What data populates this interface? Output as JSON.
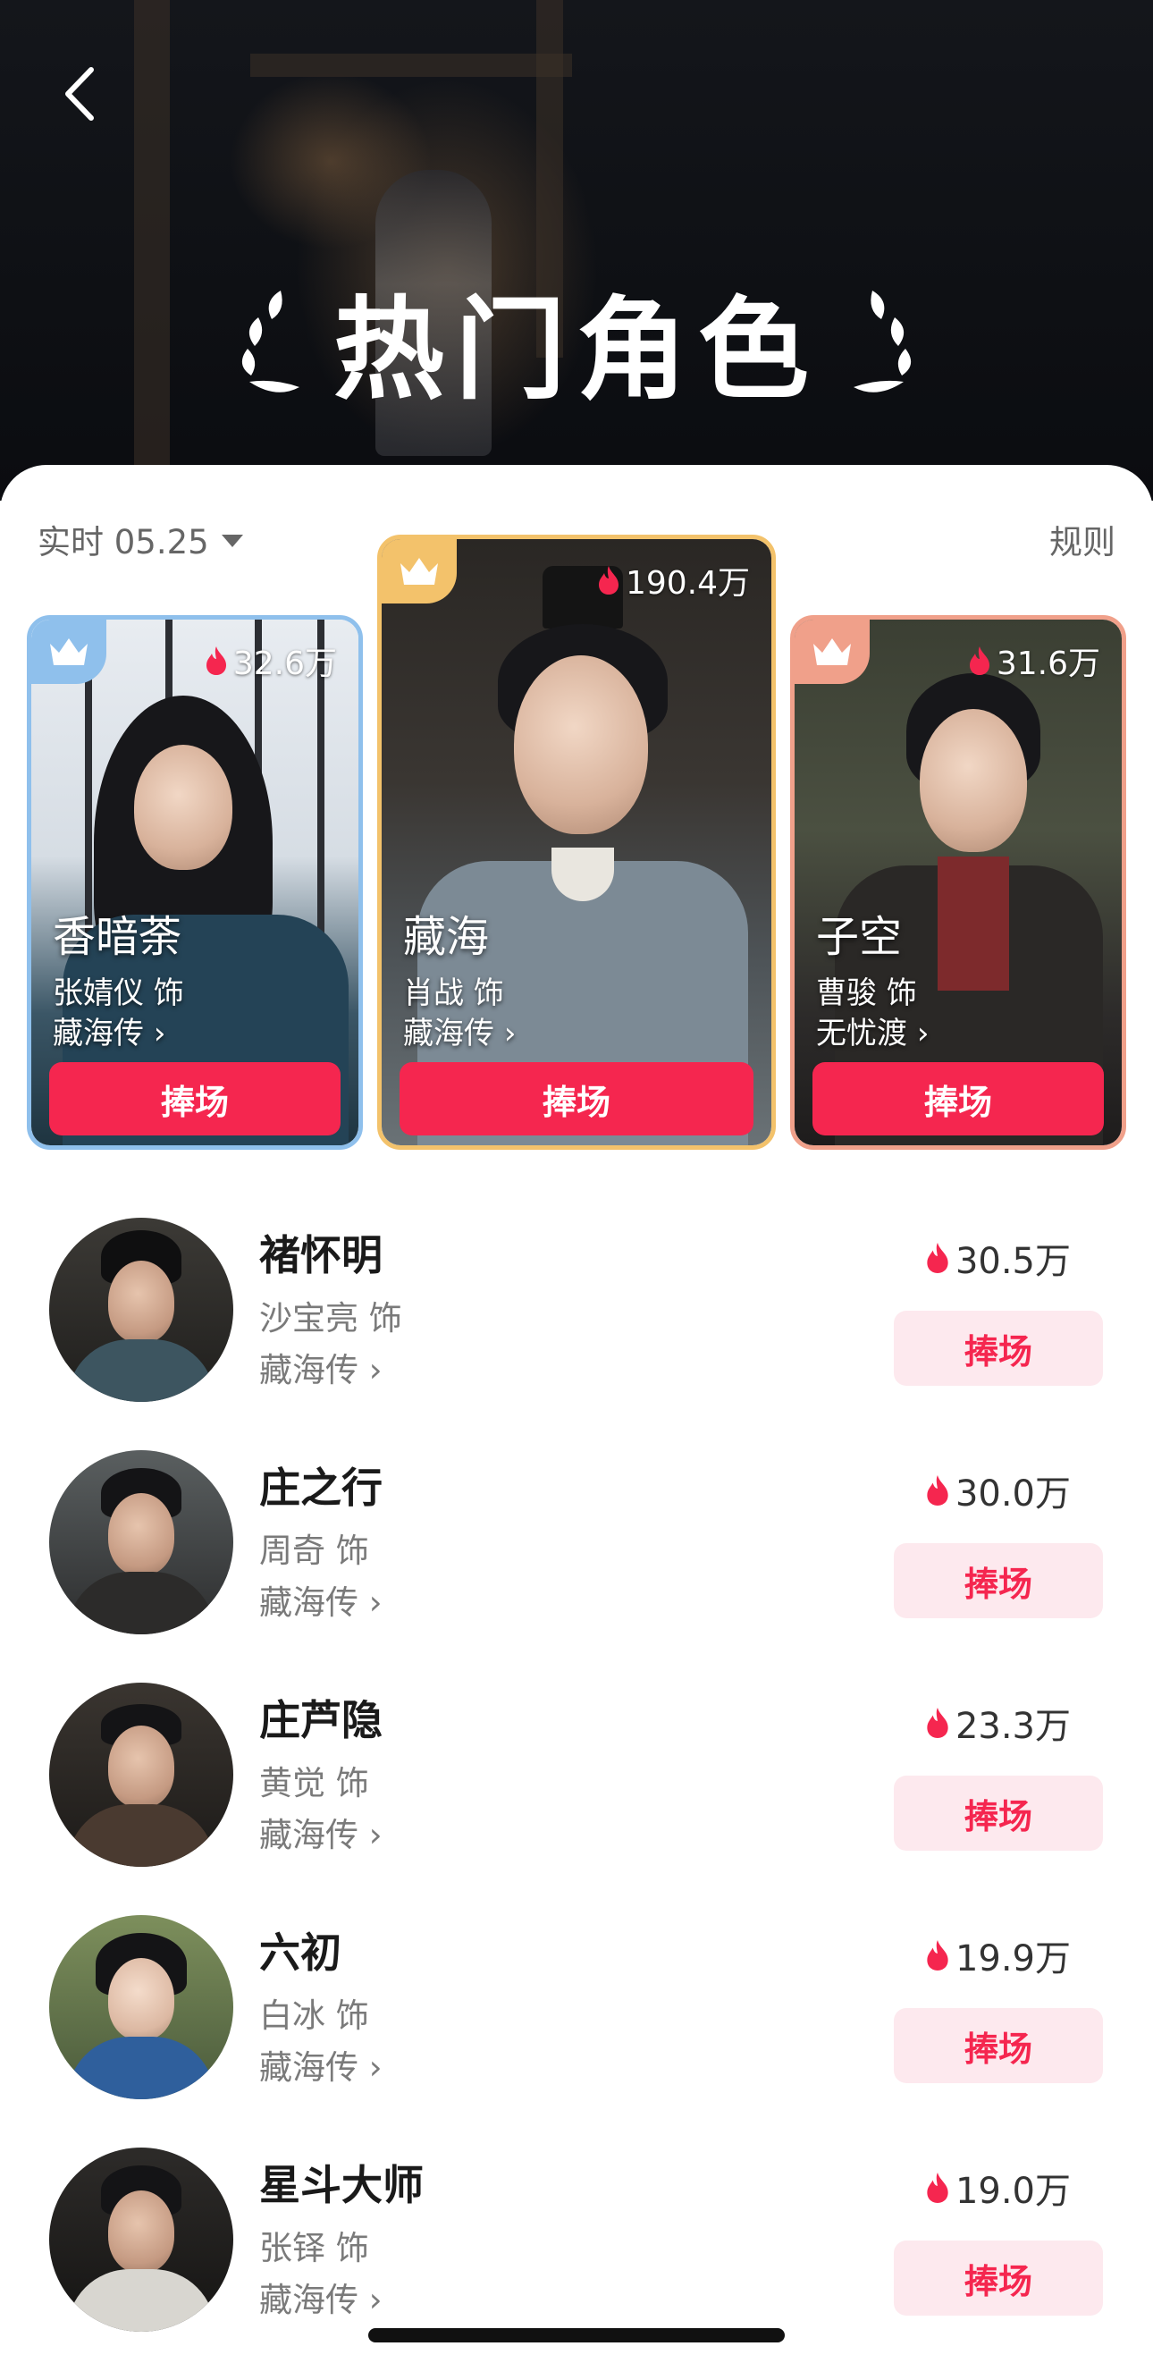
{
  "header": {
    "title": "热门角色",
    "back_icon": "chevron-left-icon"
  },
  "filter": {
    "date_label": "实时 05.25",
    "rules_label": "规则"
  },
  "colors": {
    "accent": "#f5264f",
    "accent_light": "#fde9ee",
    "gold": "#f3c26b",
    "silver_blue": "#8fc0ec",
    "bronze": "#f0a08a"
  },
  "podium": {
    "first": {
      "name": "藏海",
      "actor": "肖战 饰",
      "show": "藏海传",
      "heat": "190.4万",
      "cheer_label": "捧场"
    },
    "second": {
      "name": "香暗荼",
      "actor": "张婧仪 饰",
      "show": "藏海传",
      "heat": "32.6万",
      "cheer_label": "捧场"
    },
    "third": {
      "name": "子空",
      "actor": "曹骏 饰",
      "show": "无忧渡",
      "heat": "31.6万",
      "cheer_label": "捧场"
    }
  },
  "list": [
    {
      "name": "褚怀明",
      "actor": "沙宝亮 饰",
      "show": "藏海传",
      "heat": "30.5万",
      "cheer_label": "捧场"
    },
    {
      "name": "庄之行",
      "actor": "周奇 饰",
      "show": "藏海传",
      "heat": "30.0万",
      "cheer_label": "捧场"
    },
    {
      "name": "庄芦隐",
      "actor": "黄觉 饰",
      "show": "藏海传",
      "heat": "23.3万",
      "cheer_label": "捧场"
    },
    {
      "name": "六初",
      "actor": "白冰 饰",
      "show": "藏海传",
      "heat": "19.9万",
      "cheer_label": "捧场"
    },
    {
      "name": "星斗大师",
      "actor": "张铎 饰",
      "show": "藏海传",
      "heat": "19.0万",
      "cheer_label": "捧场"
    }
  ]
}
